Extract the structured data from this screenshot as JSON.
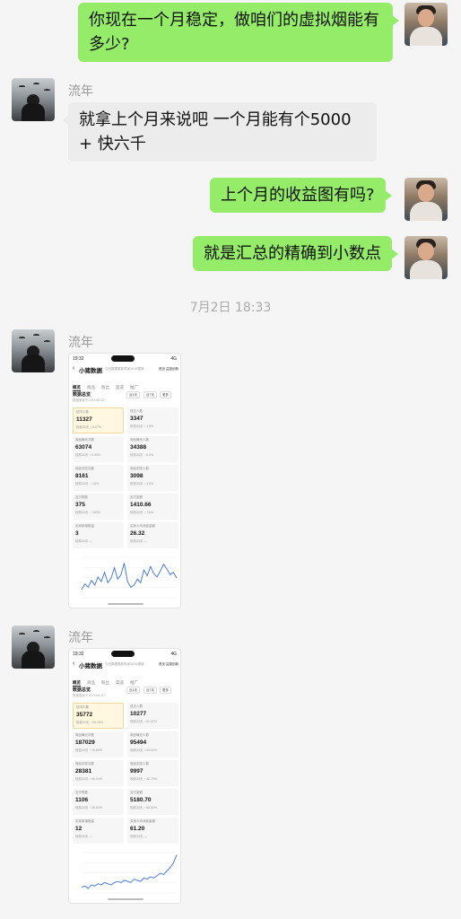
{
  "messages": {
    "m1": "你现在一个月稳定，做咱们的虚拟烟能有多少?",
    "m2_sender": "流年",
    "m2": "就拿上个月来说吧 一个月能有个5000 + 快六千",
    "m3": "上个月的收益图有吗?",
    "m4": "就是汇总的精确到小数点",
    "time_divider": "7月2日 18:33",
    "m5_sender": "流年",
    "m6_sender": "流年"
  },
  "shot1": {
    "status_time": "19:32",
    "status_icons": "4G",
    "app_title": "小猪数据",
    "app_sub": "今日数据更新时间18:00更新",
    "app_links": "首页  益猫创新",
    "tabs": [
      "概览",
      "商品",
      "粉丝",
      "渠道",
      "推广"
    ],
    "section_title": "数据总览",
    "section_date": "数据更新于2023-06-30",
    "ranges": [
      "近1天",
      "近7天",
      "更多"
    ],
    "cells": [
      {
        "label": "访问人数",
        "value": "11327",
        "change": "较前30天 ↑ 6.07%",
        "highlight": true
      },
      {
        "label": "成交人数",
        "value": "3347",
        "change": "较前30天 ↑ 1.5%",
        "highlight": false
      },
      {
        "label": "商品曝光次数",
        "value": "63074",
        "change": "较前30天 ↑ 0.99%",
        "highlight": false
      },
      {
        "label": "商品曝光人数",
        "value": "34388",
        "change": "较前30天 ↑ 8.0%",
        "highlight": false
      },
      {
        "label": "商品浏览次数",
        "value": "8161",
        "change": "较前30天 ↓ 1.8%",
        "highlight": false
      },
      {
        "label": "商品浏览人数",
        "value": "3098",
        "change": "较前30天 ↑ 1.2%",
        "highlight": false
      },
      {
        "label": "支付笔数",
        "value": "375",
        "change": "较前30天 ↓ 1.89%",
        "highlight": false
      },
      {
        "label": "支付金额",
        "value": "1410.66",
        "change": "较前30天 ↑ 7.6%",
        "highlight": false
      },
      {
        "label": "买家新增数量",
        "value": "3",
        "change": "较前30天 —",
        "highlight": false
      },
      {
        "label": "买家人均消费金额",
        "value": "26.32",
        "change": "较前30天 —",
        "highlight": false
      }
    ],
    "chart_data": {
      "type": "line",
      "values": [
        7,
        12,
        9,
        15,
        11,
        18,
        14,
        22,
        13,
        17,
        26,
        16,
        20,
        30,
        14,
        9,
        11,
        16,
        13,
        24,
        19,
        27,
        21,
        18,
        23,
        29,
        25,
        20,
        22,
        17
      ],
      "ylim": [
        0,
        35
      ],
      "color": "#3b6fe0"
    }
  },
  "shot2": {
    "status_time": "19:32",
    "status_icons": "4G",
    "app_title": "小猪数据",
    "app_sub": "今日数据更新时间18:00更新",
    "app_links": "首页  益猫创新",
    "tabs": [
      "概览",
      "商品",
      "粉丝",
      "渠道",
      "推广"
    ],
    "section_title": "数据总览",
    "section_date": "数据更新于2023-06-30",
    "ranges": [
      "近1天",
      "近7天",
      "更多"
    ],
    "cells": [
      {
        "label": "访问人数",
        "value": "35772",
        "change": "较前30天 ↑ 66.18%",
        "highlight": true
      },
      {
        "label": "成交人数",
        "value": "10277",
        "change": "较前30天 ↑ 51.47%",
        "highlight": false
      },
      {
        "label": "商品曝光次数",
        "value": "187029",
        "change": "较前30天 ↑ 30.69%",
        "highlight": false
      },
      {
        "label": "商品曝光人数",
        "value": "95494",
        "change": "较前30天 ↑ 29.61%",
        "highlight": false
      },
      {
        "label": "商品浏览次数",
        "value": "28381",
        "change": "较前30天 ↑ 50.10%",
        "highlight": false
      },
      {
        "label": "商品浏览人数",
        "value": "9997",
        "change": "较前30天 ↑ 42.73%",
        "highlight": false
      },
      {
        "label": "支付笔数",
        "value": "1106",
        "change": "较前30天 ↑ 35.54%",
        "highlight": false
      },
      {
        "label": "支付金额",
        "value": "5180.70",
        "change": "较前30天 ↑ 52.84%",
        "highlight": false
      },
      {
        "label": "买家新增数量",
        "value": "12",
        "change": "较前30天 —",
        "highlight": false
      },
      {
        "label": "买家人均消费金额",
        "value": "61.20",
        "change": "较前30天 —",
        "highlight": false
      }
    ],
    "chart_data": {
      "type": "line",
      "values": [
        5,
        6,
        4,
        7,
        6,
        8,
        7,
        9,
        8,
        7,
        9,
        10,
        9,
        11,
        10,
        9,
        12,
        11,
        10,
        13,
        12,
        14,
        13,
        15,
        17,
        16,
        19,
        22,
        26,
        33
      ],
      "ylim": [
        0,
        35
      ],
      "color": "#3b6fe0"
    }
  }
}
